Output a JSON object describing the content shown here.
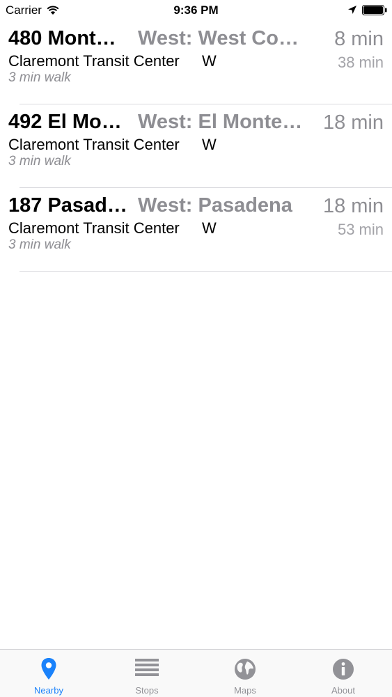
{
  "status_bar": {
    "carrier": "Carrier",
    "time": "9:36 PM",
    "icons": [
      "wifi-icon",
      "location-arrow-icon",
      "battery-icon"
    ]
  },
  "departures": [
    {
      "route": "480 Mont…",
      "destination": "West: West Co…",
      "next": "8 min",
      "following": "38 min",
      "stop": "Claremont Transit Center",
      "direction": "W",
      "walk": "3 min walk"
    },
    {
      "route": "492 El Mo…",
      "destination": "West: El Monte…",
      "next": "18 min",
      "following": "",
      "stop": "Claremont Transit Center",
      "direction": "W",
      "walk": "3 min walk"
    },
    {
      "route": "187 Pasad…",
      "destination": "West: Pasadena",
      "next": "18 min",
      "following": "53 min",
      "stop": "Claremont Transit Center",
      "direction": "W",
      "walk": "3 min walk"
    }
  ],
  "tabs": [
    {
      "label": "Nearby",
      "icon": "map-pin-icon",
      "active": true
    },
    {
      "label": "Stops",
      "icon": "list-icon",
      "active": false
    },
    {
      "label": "Maps",
      "icon": "globe-icon",
      "active": false
    },
    {
      "label": "About",
      "icon": "info-icon",
      "active": false
    }
  ],
  "colors": {
    "accent": "#1a82fb",
    "secondary_text": "#8e8e93",
    "tab_inactive": "#929297"
  }
}
